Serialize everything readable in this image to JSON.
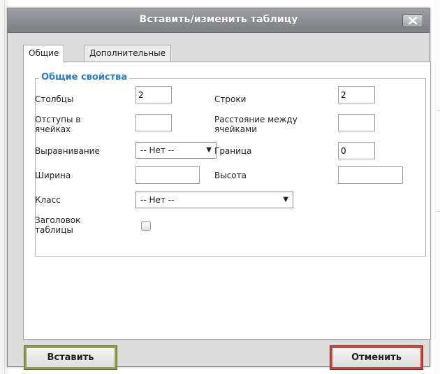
{
  "dialog": {
    "title": "Вставить/изменить таблицу",
    "close_icon": "close-x-icon"
  },
  "tabs": [
    {
      "label": "Общие",
      "active": true
    },
    {
      "label": "Дополнительные",
      "active": false
    }
  ],
  "general": {
    "legend": "Общие свойства",
    "columns_label": "Столбцы",
    "columns_value": "2",
    "rows_label": "Строки",
    "rows_value": "2",
    "cellpadding_label_1": "Отступы в",
    "cellpadding_label_2": "ячейках",
    "cellpadding_value": "",
    "cellspacing_label_1": "Расстояние между",
    "cellspacing_label_2": "ячейками",
    "cellspacing_value": "",
    "align_label": "Выравнивание",
    "align_value": "-- Нет --",
    "border_label": "Граница",
    "border_value": "0",
    "width_label": "Ширина",
    "width_value": "",
    "height_label": "Высота",
    "height_value": "",
    "class_label": "Класс",
    "class_value": "-- Нет --",
    "caption_label_1": "Заголовок",
    "caption_label_2": "таблицы",
    "caption_checked": false
  },
  "buttons": {
    "insert": "Вставить",
    "cancel": "Отменить"
  },
  "colors": {
    "legend_blue": "#2f7bc6",
    "insert_border": "#8fa14a",
    "cancel_border": "#c9473e"
  }
}
